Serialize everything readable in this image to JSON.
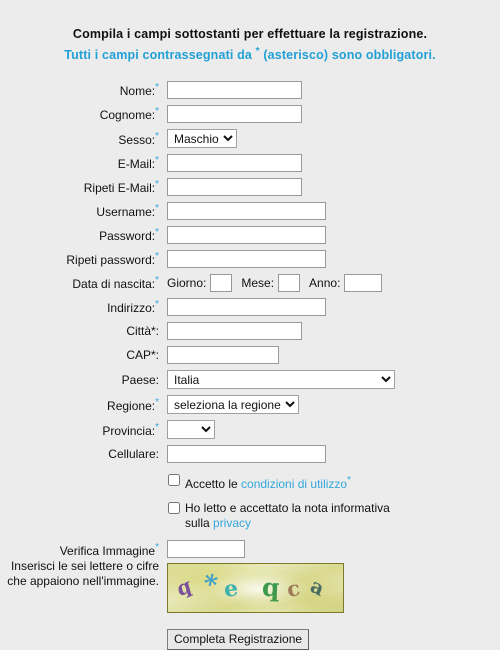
{
  "header": {
    "title": "Compila i campi sottostanti per effettuare la registrazione.",
    "subtitle_before": "Tutti i campi contrassegnati da ",
    "subtitle_asterisk": "*",
    "subtitle_after": " (asterisco) sono obbligatori."
  },
  "form": {
    "fields": [
      {
        "label": "Nome:",
        "required": true,
        "value": "",
        "type": "text"
      },
      {
        "label": "Cognome:",
        "required": true,
        "value": "",
        "type": "text"
      },
      {
        "label": "Sesso:",
        "required": true,
        "value": "Maschio",
        "type": "select"
      },
      {
        "label": "E-Mail:",
        "required": true,
        "value": "",
        "type": "text"
      },
      {
        "label": "Ripeti E-Mail:",
        "required": true,
        "value": "",
        "type": "text"
      },
      {
        "label": "Username:",
        "required": true,
        "value": "",
        "type": "text"
      },
      {
        "label": "Password:",
        "required": true,
        "value": "",
        "type": "text"
      },
      {
        "label": "Ripeti password:",
        "required": true,
        "value": "",
        "type": "text"
      },
      {
        "label": "Data di nascita:",
        "required": true,
        "value": "",
        "type": "date"
      },
      {
        "label": "Indirizzo:",
        "required": true,
        "value": "",
        "type": "text"
      },
      {
        "label": "Città*:",
        "required": false,
        "value": "",
        "type": "text"
      },
      {
        "label": "CAP*:",
        "required": false,
        "value": "",
        "type": "text"
      },
      {
        "label": "Paese:",
        "required": false,
        "value": "Italia",
        "type": "select"
      },
      {
        "label": "Regione:",
        "required": true,
        "value": "seleziona la regione",
        "type": "select"
      },
      {
        "label": "Provincia:",
        "required": true,
        "value": "",
        "type": "select"
      },
      {
        "label": "Cellulare:",
        "required": false,
        "value": "",
        "type": "text"
      }
    ],
    "sesso_label": "Sesso:",
    "sesso_value": "Maschio",
    "date": {
      "day_label": "Giorno:",
      "day_value": "",
      "month_label": "Mese:",
      "month_value": "",
      "year_label": "Anno:",
      "year_value": ""
    },
    "paese_value": "Italia",
    "regione_value": "seleziona la regione",
    "provincia_value": ""
  },
  "consents": [
    {
      "checked": false,
      "text_before": "Accetto le ",
      "link": "condizioni di utilizzo",
      "asterisk": "*",
      "text_after": ""
    },
    {
      "checked": false,
      "text_before": "Ho letto e accettato la nota informativa sulla ",
      "link": "privacy",
      "asterisk": "",
      "text_after": ""
    }
  ],
  "captcha": {
    "label_line1": "Verifica Immagine",
    "label_asterisk": "*",
    "label_line2": "Inserisci le sei lettere o cifre",
    "label_line3": "che appaiono nell'immagine.",
    "input_value": "",
    "characters": [
      "q",
      "*",
      "e",
      "q",
      "c",
      "a"
    ]
  },
  "submit": {
    "label": "Completa Registrazione"
  },
  "colors": {
    "background": "#ececec",
    "accent_blue": "#22a0d6",
    "link_blue": "#33a7da",
    "text": "#111111"
  }
}
